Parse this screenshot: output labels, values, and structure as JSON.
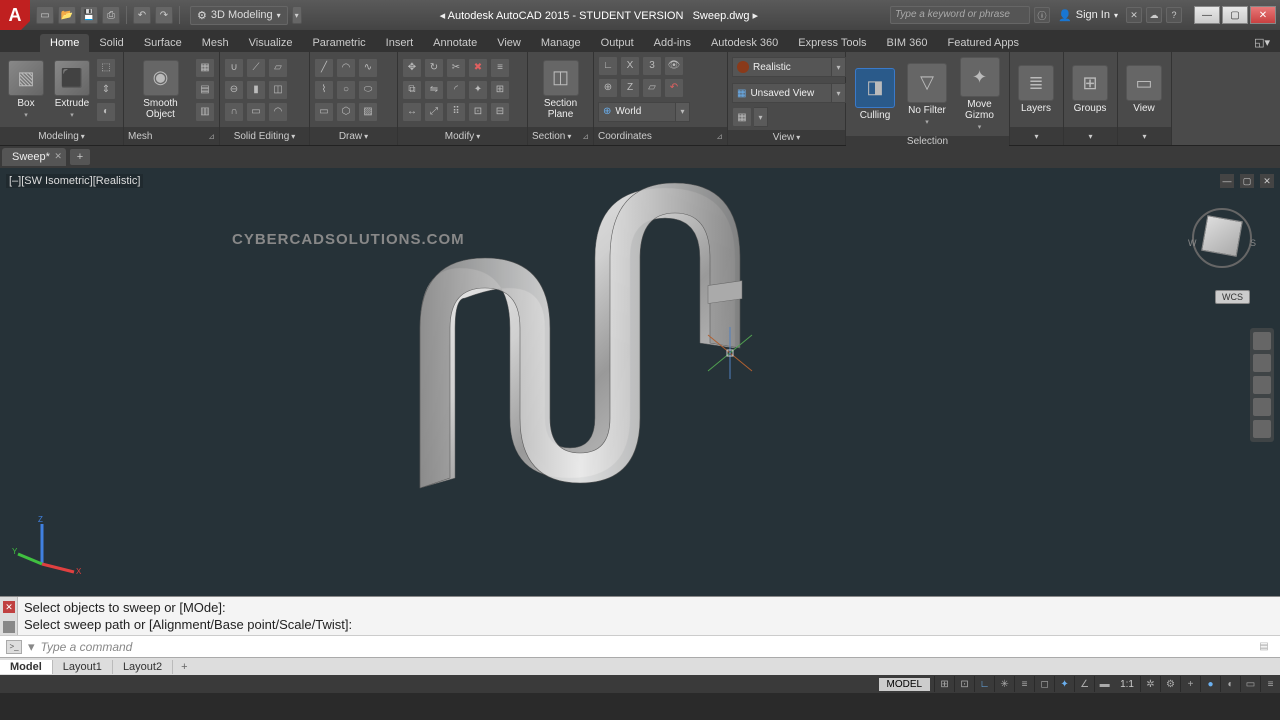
{
  "title": {
    "app": "Autodesk AutoCAD 2015 - STUDENT VERSION",
    "file": "Sweep.dwg"
  },
  "workspace": "3D Modeling",
  "search_placeholder": "Type a keyword or phrase",
  "signin": "Sign In",
  "tabs": [
    "Home",
    "Solid",
    "Surface",
    "Mesh",
    "Visualize",
    "Parametric",
    "Insert",
    "Annotate",
    "View",
    "Manage",
    "Output",
    "Add-ins",
    "Autodesk 360",
    "Express Tools",
    "BIM 360",
    "Featured Apps"
  ],
  "active_tab": "Home",
  "ribbon": {
    "modeling": {
      "title": "Modeling",
      "box": "Box",
      "extrude": "Extrude"
    },
    "mesh": {
      "title": "Mesh",
      "smooth": "Smooth Object"
    },
    "solid_editing": {
      "title": "Solid Editing"
    },
    "draw": {
      "title": "Draw"
    },
    "modify": {
      "title": "Modify"
    },
    "section": {
      "title": "Section",
      "plane": "Section Plane"
    },
    "coordinates": {
      "title": "Coordinates",
      "world": "World"
    },
    "view": {
      "title": "View",
      "visual": "Realistic",
      "named": "Unsaved View"
    },
    "selection": {
      "title": "Selection",
      "culling": "Culling",
      "nofilter": "No Filter",
      "gizmo": "Move Gizmo"
    },
    "layers": {
      "title": "Layers"
    },
    "groups": {
      "title": "Groups"
    },
    "view2": {
      "title": "View"
    }
  },
  "file_tab": "Sweep*",
  "view_label": "[–][SW Isometric][Realistic]",
  "watermark": "CYBERCADSOLUTIONS.COM",
  "wcs": "WCS",
  "cmd": {
    "line1": "Select objects to sweep or [MOde]:",
    "line2": "Select sweep path or [Alignment/Base point/Scale/Twist]:",
    "placeholder": "Type a command"
  },
  "layout_tabs": [
    "Model",
    "Layout1",
    "Layout2"
  ],
  "active_layout": "Model",
  "status": {
    "model": "MODEL",
    "scale": "1:1"
  }
}
